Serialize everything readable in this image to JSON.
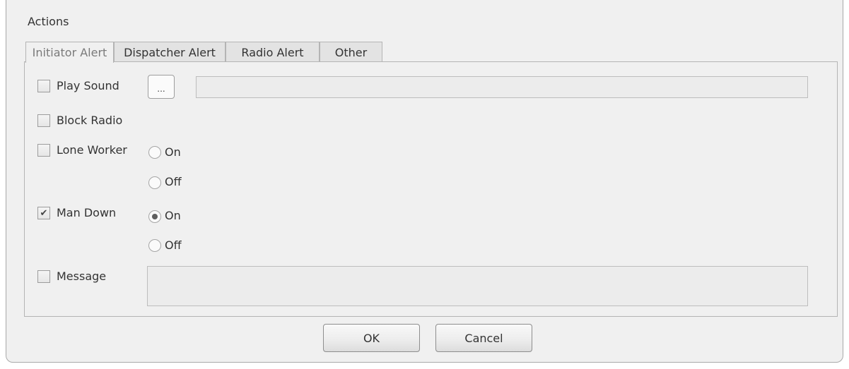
{
  "group": {
    "title": "Actions"
  },
  "tabs": [
    {
      "label": "Initiator Alert",
      "active": true
    },
    {
      "label": "Dispatcher Alert",
      "active": false
    },
    {
      "label": "Radio Alert",
      "active": false
    },
    {
      "label": "Other",
      "active": false
    }
  ],
  "play_sound": {
    "label": "Play Sound",
    "checked": false,
    "browse_label": "...",
    "path_value": ""
  },
  "block_radio": {
    "label": "Block Radio",
    "checked": false
  },
  "lone_worker": {
    "label": "Lone Worker",
    "checked": false,
    "on_label": "On",
    "off_label": "Off",
    "selected": "none"
  },
  "man_down": {
    "label": "Man Down",
    "checked": true,
    "check_glyph": "✔",
    "on_label": "On",
    "off_label": "Off",
    "selected": "On"
  },
  "message": {
    "label": "Message",
    "checked": false,
    "value": ""
  },
  "buttons": {
    "ok": "OK",
    "cancel": "Cancel"
  }
}
